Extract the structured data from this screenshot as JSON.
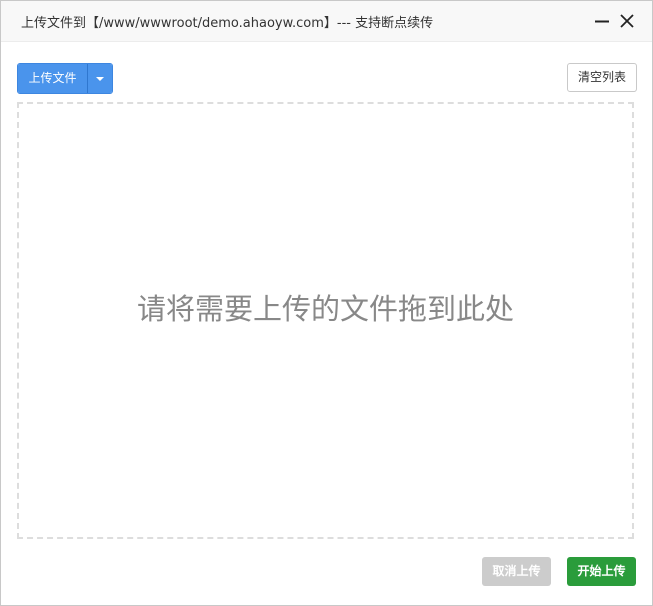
{
  "window": {
    "title": "上传文件到【/www/wwwroot/demo.ahaoyw.com】--- 支持断点续传"
  },
  "toolbar": {
    "upload_label": "上传文件",
    "clear_label": "清空列表"
  },
  "dropzone": {
    "hint": "请将需要上传的文件拖到此处"
  },
  "footer": {
    "cancel_label": "取消上传",
    "start_label": "开始上传"
  },
  "colors": {
    "primary": "#4a94ec",
    "success": "#2a9c3b",
    "disabled": "#cccccc"
  },
  "icons": {
    "minimize": "minimize-icon",
    "close": "close-icon",
    "dropdown": "caret-down-icon"
  }
}
